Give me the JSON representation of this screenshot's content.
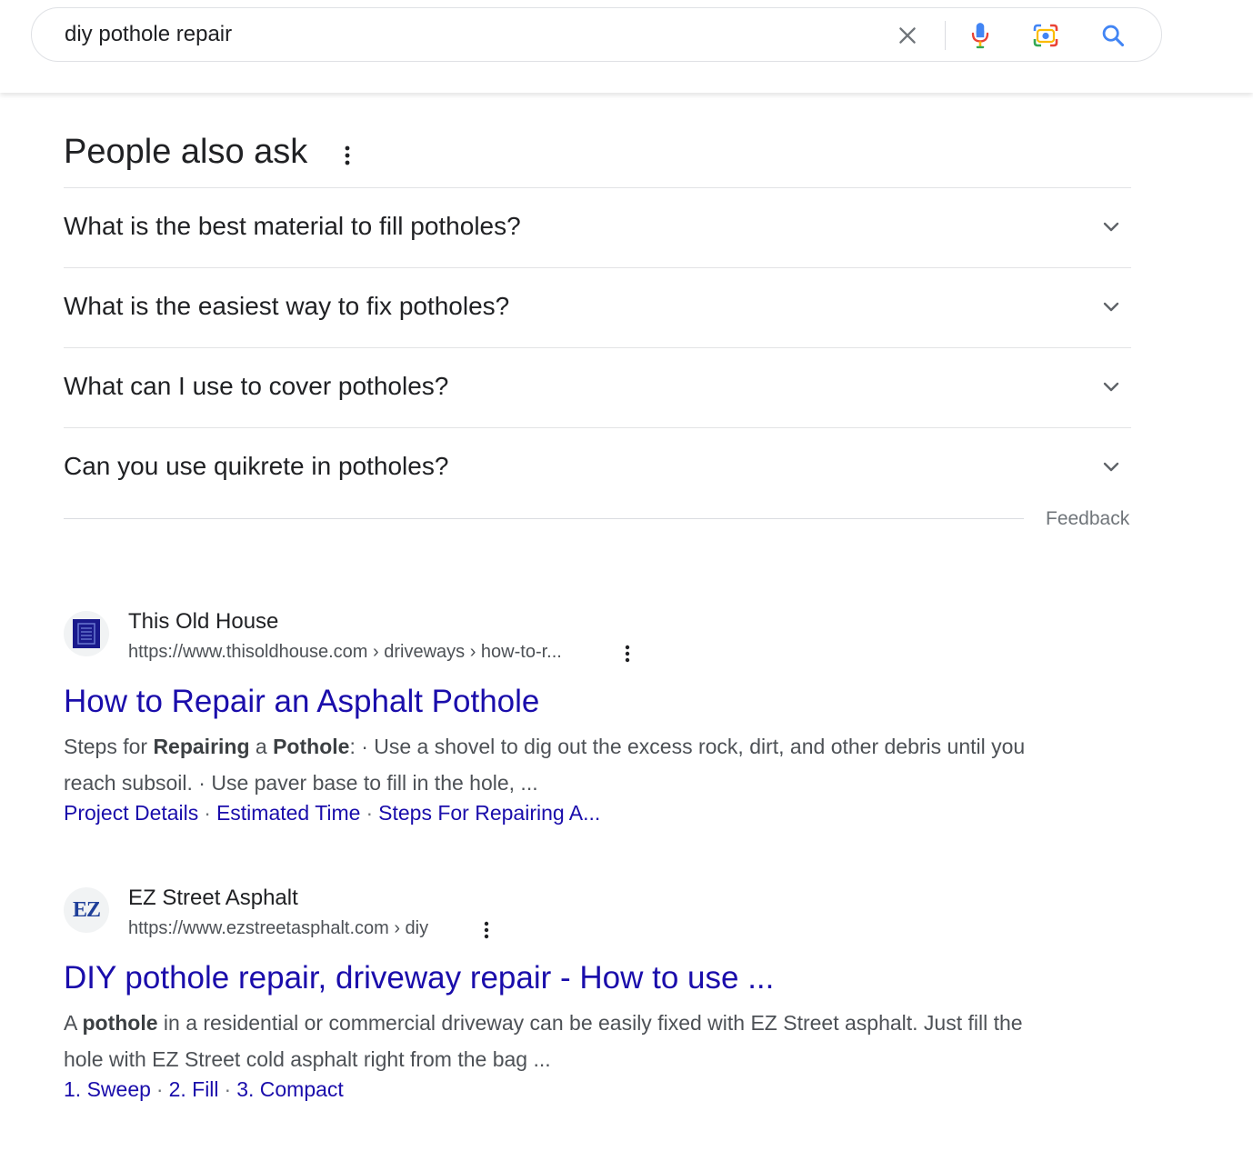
{
  "search": {
    "query": "diy pothole repair",
    "icons": {
      "clear": "close-icon",
      "voice": "microphone-icon",
      "lens": "camera-lens-icon",
      "search": "search-icon"
    }
  },
  "people_also_ask": {
    "title": "People also ask",
    "questions": [
      "What is the best material to fill potholes?",
      "What is the easiest way to fix potholes?",
      "What can I use to cover potholes?",
      "Can you use quikrete in potholes?"
    ],
    "feedback": "Feedback"
  },
  "results": [
    {
      "site_name": "This Old House",
      "url": "https://www.thisoldhouse.com › driveways › how-to-r...",
      "title": "How to Repair an Asphalt Pothole",
      "snippet": {
        "t1": "Steps for ",
        "b1": "Repairing",
        "t2": " a ",
        "b2": "Pothole",
        "t3": ": · Use a shovel to dig out the excess rock, dirt, and other debris until you reach subsoil. · Use paver base to fill in the hole, ..."
      },
      "sitelinks": [
        "Project Details",
        "Estimated Time",
        "Steps For Repairing A..."
      ],
      "favicon_color": "#1a1a8c"
    },
    {
      "site_name": "EZ Street Asphalt",
      "url": "https://www.ezstreetasphalt.com › diy",
      "title": "DIY pothole repair, driveway repair - How to use ...",
      "favicon_text": "EZ",
      "snippet": {
        "t1": "A ",
        "b1": "pothole",
        "t2": " in a residential or commercial driveway can be easily fixed with EZ Street asphalt. Just fill the hole with EZ Street cold asphalt right from the bag ..."
      },
      "sitelinks": [
        "1. Sweep",
        "2. Fill",
        "3. Compact"
      ],
      "favicon_color": "#1f3f99"
    }
  ],
  "colors": {
    "link": "#1a0dab",
    "text": "#202124",
    "muted": "#4d5156",
    "divider": "#e2e3e5"
  }
}
